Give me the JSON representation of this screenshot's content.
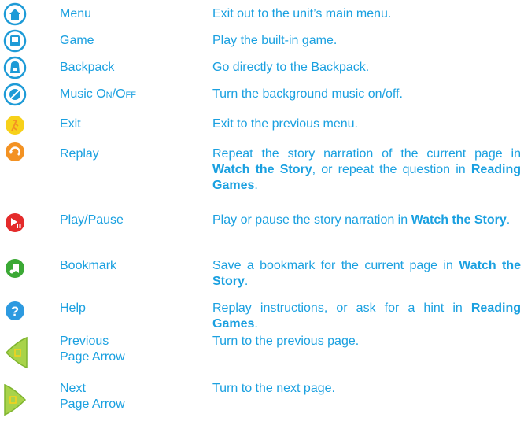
{
  "rows": [
    {
      "icon": "menu-icon",
      "name": "Menu",
      "desc": "Exit out to the unit’s main menu."
    },
    {
      "icon": "game-icon",
      "name": "Game",
      "desc": "Play the built-in game."
    },
    {
      "icon": "backpack-icon",
      "name": "Backpack",
      "desc": "Go directly to the Backpack."
    },
    {
      "icon": "music-icon",
      "name_a": "Music ",
      "name_b": "On/Off",
      "desc": "Turn the background music on/off."
    },
    {
      "icon": "exit-icon",
      "name": "Exit",
      "desc": "Exit to the previous menu."
    },
    {
      "icon": "replay-icon",
      "name": "Replay",
      "desc_1": "Repeat the story narration of the current page in ",
      "desc_2": "Watch the Story",
      "desc_3": ", or repeat the question in ",
      "desc_4": "Reading Games",
      "desc_5": "."
    },
    {
      "icon": "play-pause-icon",
      "name": "Play/Pause",
      "desc_1": "Play or pause the story narration in ",
      "desc_2": "Watch the Story",
      "desc_3": "."
    },
    {
      "icon": "bookmark-icon",
      "name": "Bookmark",
      "desc_1": "Save a bookmark for the current page in ",
      "desc_2": "Watch the Story",
      "desc_3": "."
    },
    {
      "icon": "help-icon",
      "name": "Help",
      "desc_1": "Replay instructions, or ask for a hint in ",
      "desc_2": "Reading Games",
      "desc_3": "."
    },
    {
      "icon": "previous-page-arrow-icon",
      "name": "Previous\nPage Arrow",
      "desc": "Turn to the previous page."
    },
    {
      "icon": "next-page-arrow-icon",
      "name": "Next\nPage Arrow",
      "desc": "Turn to the next page."
    }
  ],
  "colors": {
    "text": "#1aa0e0",
    "icon_blue": "#1e9bd7",
    "exit_yellow": "#f7d11a",
    "replay_orange": "#f39223",
    "play_red": "#e42b2b",
    "bookmark_green": "#3ba935",
    "help_blue": "#2d9ae0",
    "arrow_green": "#a8d34a"
  }
}
